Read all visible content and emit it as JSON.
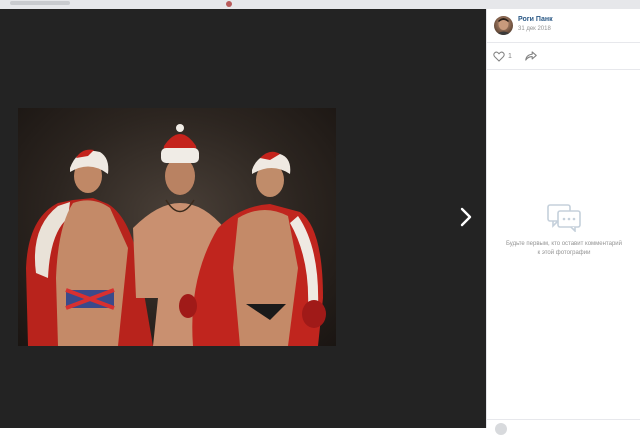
{
  "author": {
    "name": "Роги Панк",
    "date": "31 дек 2018"
  },
  "actions": {
    "likes": "1"
  },
  "comments": {
    "empty_text": "Будьте первым, кто оставит комментарий к этой фотографии"
  },
  "colors": {
    "viewer_bg": "#232323",
    "link_blue": "#2a5885",
    "muted": "#939393"
  }
}
